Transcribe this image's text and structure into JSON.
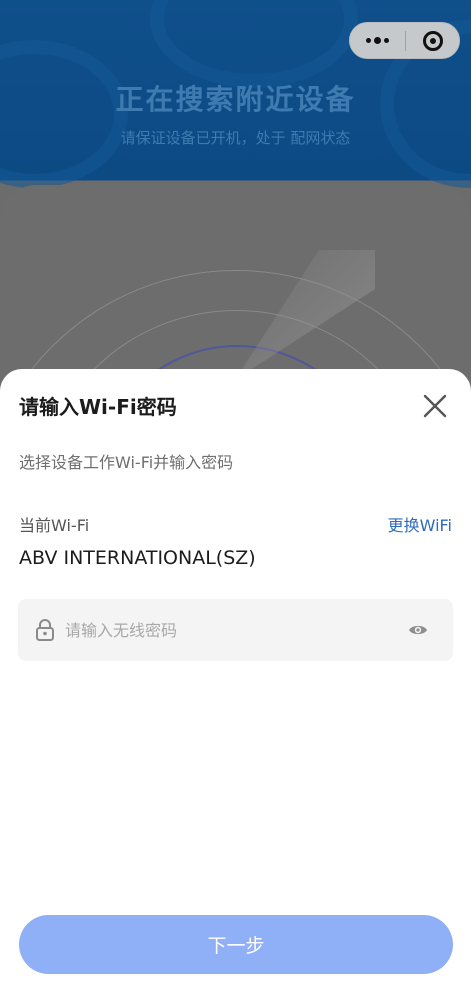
{
  "background": {
    "title": "正在搜索附近设备",
    "subtitle": "请保证设备已开机，处于 配网状态"
  },
  "capsule": {
    "more_icon": "more-dots-icon",
    "close_icon": "target-circle-icon"
  },
  "sheet": {
    "title": "请输入Wi-Fi密码",
    "close_icon": "close-x-icon",
    "description": "选择设备工作Wi-Fi并输入密码",
    "current_wifi_label": "当前Wi-Fi",
    "change_wifi_label": "更换WiFi",
    "ssid": "ABV INTERNATIONAL(SZ)",
    "password": {
      "placeholder": "请输入无线密码",
      "value": "",
      "lock_icon": "lock-icon",
      "visibility_icon": "eye-icon"
    },
    "next_button": "下一步"
  },
  "colors": {
    "accent_link": "#2d6bbf",
    "next_button_bg": "#8fb0f6",
    "header_bg": "#0f4f8a"
  }
}
